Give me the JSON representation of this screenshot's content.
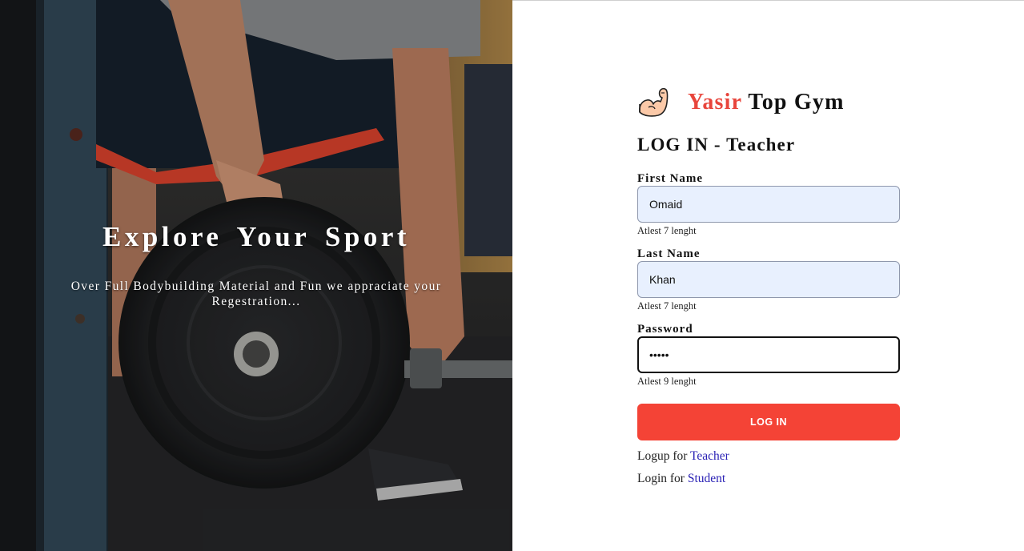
{
  "hero": {
    "title": "Explore Your Sport",
    "subtitle": "Over Full Bodybuilding Material and Fun we appraciate your Regestration..."
  },
  "brand": {
    "name_accent": "Yasir",
    "name_rest": "Top Gym",
    "icon": "flexed-biceps-icon",
    "accent_color": "#e8453c"
  },
  "form": {
    "title": "LOG IN - Teacher",
    "first_name": {
      "label": "First Name",
      "value": "Omaid",
      "hint": "Atlest 7 lenght"
    },
    "last_name": {
      "label": "Last Name",
      "value": "Khan",
      "hint": "Atlest 7 lenght"
    },
    "password": {
      "label": "Password",
      "value": "•••••",
      "hint": "Atlest 9 lenght"
    },
    "submit_label": "LOG IN",
    "submit_color": "#f44336"
  },
  "links": {
    "signup_prefix": "Logup for",
    "signup_link": "Teacher",
    "login_prefix": "Login for",
    "login_link": "Student"
  }
}
